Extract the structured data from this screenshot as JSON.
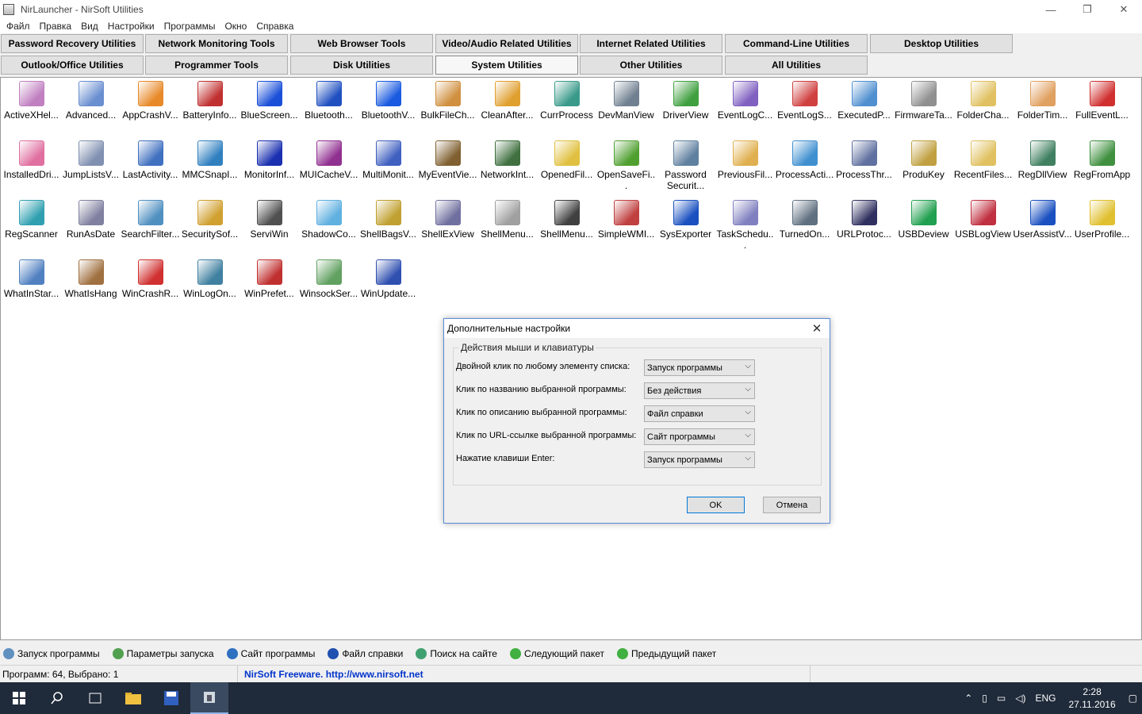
{
  "window": {
    "title": "NirLauncher  -  NirSoft Utilities"
  },
  "menu": [
    "Файл",
    "Правка",
    "Вид",
    "Настройки",
    "Программы",
    "Окно",
    "Справка"
  ],
  "tabs_row1": [
    "Password Recovery Utilities",
    "Network Monitoring Tools",
    "Web Browser Tools",
    "Video/Audio Related Utilities",
    "Internet Related Utilities",
    "Command-Line Utilities",
    "Desktop Utilities"
  ],
  "tabs_row2": [
    "Outlook/Office Utilities",
    "Programmer Tools",
    "Disk Utilities",
    "System Utilities",
    "Other Utilities",
    "All Utilities"
  ],
  "active_tab": "System Utilities",
  "icons": [
    {
      "label": "ActiveXHel...",
      "color": "#c080c0"
    },
    {
      "label": "Advanced...",
      "color": "#6a8fd0"
    },
    {
      "label": "AppCrashV...",
      "color": "#e88a2a"
    },
    {
      "label": "BatteryInfo...",
      "color": "#c03030"
    },
    {
      "label": "BlueScreen...",
      "color": "#1a4fd8"
    },
    {
      "label": "Bluetooth...",
      "color": "#2050c0"
    },
    {
      "label": "BluetoothV...",
      "color": "#1a5ae0"
    },
    {
      "label": "BulkFileCh...",
      "color": "#d09040"
    },
    {
      "label": "CleanAfter...",
      "color": "#e0a030"
    },
    {
      "label": "CurrProcess",
      "color": "#3a9a8a"
    },
    {
      "label": "DevManView",
      "color": "#708090"
    },
    {
      "label": "DriverView",
      "color": "#40a040"
    },
    {
      "label": "EventLogC...",
      "color": "#8060c0"
    },
    {
      "label": "EventLogS...",
      "color": "#d04040"
    },
    {
      "label": "ExecutedP...",
      "color": "#5090d0"
    },
    {
      "label": "FirmwareTa...",
      "color": "#909090"
    },
    {
      "label": "FolderCha...",
      "color": "#e0c060"
    },
    {
      "label": "FolderTim...",
      "color": "#e0a060"
    },
    {
      "label": "FullEventL...",
      "color": "#d03030"
    },
    {
      "label": "InstalledDri...",
      "color": "#e070a0"
    },
    {
      "label": "JumpListsV...",
      "color": "#8090b0"
    },
    {
      "label": "LastActivity...",
      "color": "#4070c0"
    },
    {
      "label": "MMCSnapI...",
      "color": "#3080c0"
    },
    {
      "label": "MonitorInf...",
      "color": "#1a30b0"
    },
    {
      "label": "MUICacheV...",
      "color": "#903090"
    },
    {
      "label": "MultiMonit...",
      "color": "#4060c0"
    },
    {
      "label": "MyEventVie...",
      "color": "#806030"
    },
    {
      "label": "NetworkInt...",
      "color": "#407040"
    },
    {
      "label": "OpenedFil...",
      "color": "#e0c040"
    },
    {
      "label": "OpenSaveFi...",
      "color": "#50a030"
    },
    {
      "label": "Password Securit...",
      "color": "#6080a0"
    },
    {
      "label": "PreviousFil...",
      "color": "#e0b050"
    },
    {
      "label": "ProcessActi...",
      "color": "#4090d0"
    },
    {
      "label": "ProcessThr...",
      "color": "#6070a0"
    },
    {
      "label": "ProduKey",
      "color": "#c0a040"
    },
    {
      "label": "RecentFiles...",
      "color": "#e0c060"
    },
    {
      "label": "RegDllView",
      "color": "#408060"
    },
    {
      "label": "RegFromApp",
      "color": "#409040"
    },
    {
      "label": "RegScanner",
      "color": "#30a0b0"
    },
    {
      "label": "RunAsDate",
      "color": "#8080a0"
    },
    {
      "label": "SearchFilter...",
      "color": "#5090c0"
    },
    {
      "label": "SecuritySof...",
      "color": "#d0a030"
    },
    {
      "label": "ServiWin",
      "color": "#505050"
    },
    {
      "label": "ShadowCo...",
      "color": "#60b0e0"
    },
    {
      "label": "ShellBagsV...",
      "color": "#c0a030"
    },
    {
      "label": "ShellExView",
      "color": "#7070a0"
    },
    {
      "label": "ShellMenu...",
      "color": "#a0a0a0"
    },
    {
      "label": "ShellMenu...",
      "color": "#404040"
    },
    {
      "label": "SimpleWMI...",
      "color": "#c04040"
    },
    {
      "label": "SysExporter",
      "color": "#1a50c0"
    },
    {
      "label": "TaskSchedu...",
      "color": "#8080c0"
    },
    {
      "label": "TurnedOn...",
      "color": "#607080"
    },
    {
      "label": "URLProtoc...",
      "color": "#303060"
    },
    {
      "label": "USBDeview",
      "color": "#20a050"
    },
    {
      "label": "USBLogView",
      "color": "#c03040"
    },
    {
      "label": "UserAssistV...",
      "color": "#1a50c0"
    },
    {
      "label": "UserProfile...",
      "color": "#e0c030"
    },
    {
      "label": "WhatInStar...",
      "color": "#5080c0"
    },
    {
      "label": "WhatIsHang",
      "color": "#a07040"
    },
    {
      "label": "WinCrashR...",
      "color": "#d03030"
    },
    {
      "label": "WinLogOn...",
      "color": "#4080a0"
    },
    {
      "label": "WinPrefet...",
      "color": "#c03030"
    },
    {
      "label": "WinsockSer...",
      "color": "#60a060"
    },
    {
      "label": "WinUpdate...",
      "color": "#3050b0"
    }
  ],
  "actions": [
    {
      "label": "Запуск программы",
      "color": "#6090c0"
    },
    {
      "label": "Параметры запуска",
      "color": "#50a050"
    },
    {
      "label": "Сайт программы",
      "color": "#3070c0"
    },
    {
      "label": "Файл справки",
      "color": "#2050b0"
    },
    {
      "label": "Поиск на сайте",
      "color": "#40a070"
    },
    {
      "label": "Следующий пакет",
      "color": "#40b040"
    },
    {
      "label": "Предыдущий пакет",
      "color": "#40b040"
    }
  ],
  "status": {
    "count": "Программ: 64, Выбрано: 1",
    "link": "NirSoft Freeware.  http://www.nirsoft.net"
  },
  "dialog": {
    "title": "Дополнительные настройки",
    "group": "Действия мыши и клавиатуры",
    "rows": [
      {
        "label": "Двойной клик по любому элементу списка:",
        "value": "Запуск программы"
      },
      {
        "label": "Клик по названию выбранной программы:",
        "value": "Без действия"
      },
      {
        "label": "Клик по описанию выбранной программы:",
        "value": "Файл справки"
      },
      {
        "label": "Клик по URL-ссылке выбранной программы:",
        "value": "Сайт программы"
      },
      {
        "label": "Нажатие клавиши Enter:",
        "value": "Запуск программы"
      }
    ],
    "ok": "OK",
    "cancel": "Отмена"
  },
  "taskbar": {
    "lang": "ENG",
    "time": "2:28",
    "date": "27.11.2016"
  }
}
